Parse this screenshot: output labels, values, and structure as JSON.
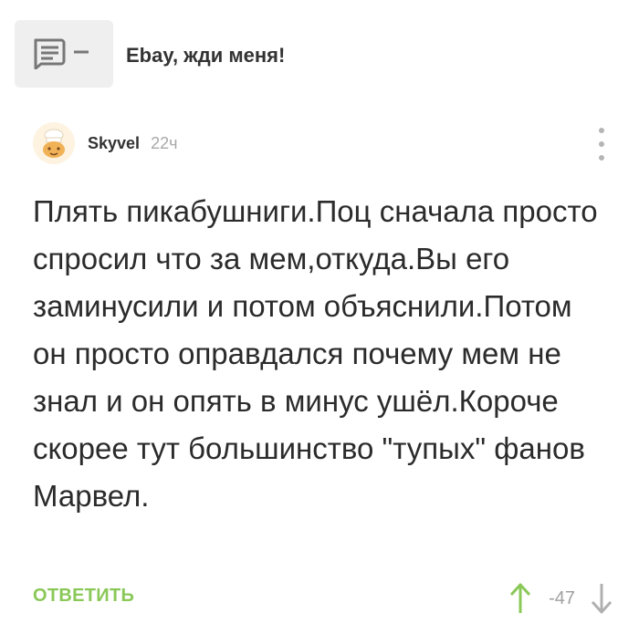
{
  "post": {
    "title": "Ebay, жди меня!"
  },
  "comment": {
    "author": "Skyvel",
    "time": "22ч",
    "text": "Плять пикабушниги.Поц сначала просто спросил что за мем,откуда.Вы его заминусили и потом объяснили.Потом он просто оправдался почему мем не знал и он опять в минус ушёл.Короче скорее тут большинство \"тупых\" фанов Марвел.",
    "reply_label": "ОТВЕТИТЬ",
    "score": "-47"
  },
  "icons": {
    "post": "comment-collapse-icon",
    "avatar": "chef-avatar",
    "more": "more-vertical-icon",
    "upvote": "arrow-up-icon",
    "downvote": "arrow-down-icon"
  },
  "colors": {
    "accent": "#8ac858",
    "muted": "#a8a8a8",
    "box": "#efefef"
  }
}
